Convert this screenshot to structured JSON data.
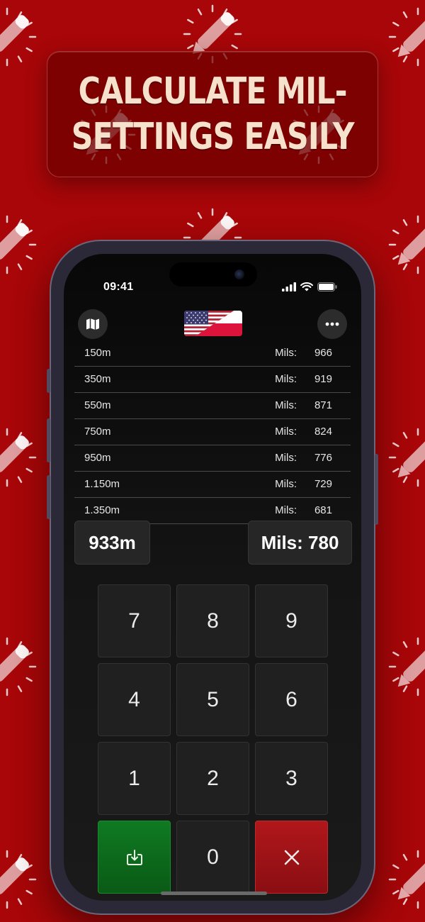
{
  "banner": {
    "line1": "CALCULATE MIL-",
    "line2": "SETTINGS EASILY"
  },
  "status_bar": {
    "time": "09:41",
    "icons": [
      "cellular-signal-icon",
      "wifi-icon",
      "battery-icon"
    ]
  },
  "header": {
    "left_button_icon": "map-icon",
    "flag": "us-poland-flag",
    "right_button_icon": "more-icon"
  },
  "table": {
    "mils_label": "Mils:",
    "rows": [
      {
        "distance": "150m",
        "mils": "966"
      },
      {
        "distance": "350m",
        "mils": "919"
      },
      {
        "distance": "550m",
        "mils": "871"
      },
      {
        "distance": "750m",
        "mils": "824"
      },
      {
        "distance": "950m",
        "mils": "776"
      },
      {
        "distance": "1.150m",
        "mils": "729"
      },
      {
        "distance": "1.350m",
        "mils": "681"
      }
    ]
  },
  "current": {
    "distance": "933m",
    "mils": "Mils: 780"
  },
  "keypad": {
    "keys": [
      "7",
      "8",
      "9",
      "4",
      "5",
      "6",
      "1",
      "2",
      "3"
    ],
    "zero": "0",
    "save_icon": "save-download-icon",
    "clear_icon": "close-icon"
  },
  "colors": {
    "background": "#a80608",
    "banner_text": "#f6e2cc",
    "save_key": "#0f7a22",
    "clear_key": "#b0171b"
  }
}
